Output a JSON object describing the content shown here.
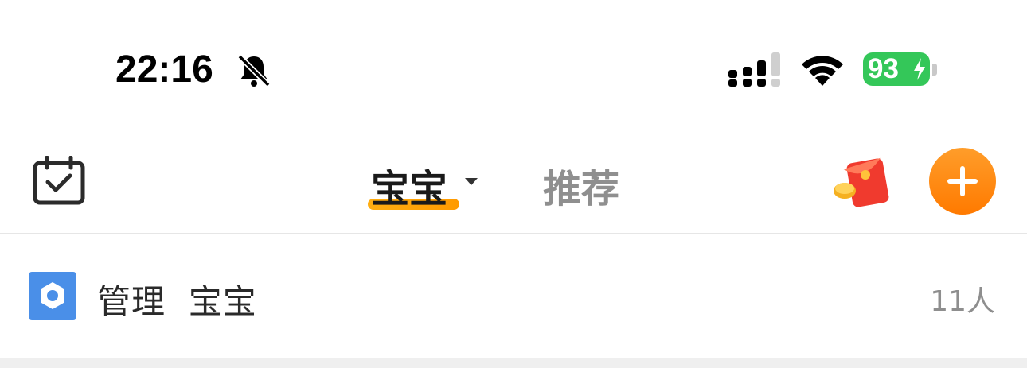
{
  "status_bar": {
    "time": "22:16",
    "battery": "93",
    "icons": [
      "bell-slash-icon",
      "signal-icon",
      "wifi-icon",
      "battery-icon",
      "charging-bolt-icon"
    ]
  },
  "nav": {
    "tab_active": "宝宝",
    "tab_other": "推荐",
    "icons": [
      "calendar-check-icon",
      "caret-down-icon",
      "red-packet-icon",
      "plus-icon"
    ],
    "accent_color": "#ff9a00"
  },
  "manage_row": {
    "title": "管理  宝宝",
    "count": "11人",
    "icon": "gear-icon",
    "icon_bg": "#4a8fe8"
  }
}
